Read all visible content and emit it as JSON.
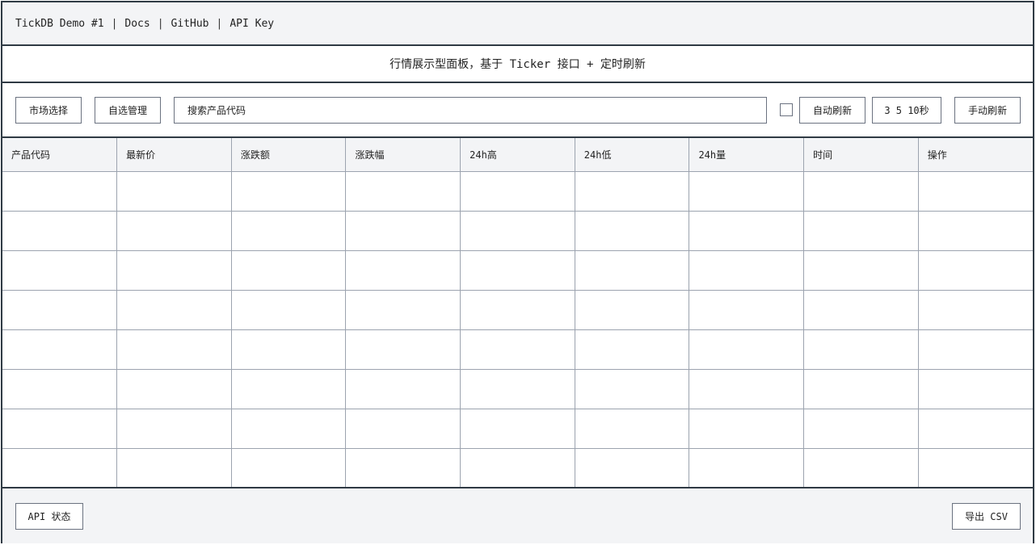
{
  "topbar": {
    "title": "TickDB Demo #1",
    "links": [
      "Docs",
      "GitHub",
      "API Key"
    ],
    "separator": "|"
  },
  "subtitle": "行情展示型面板，基于 Ticker 接口 + 定时刷新",
  "toolbar": {
    "market_label": "市场选择",
    "watchlist_label": "自选管理",
    "search_placeholder": "搜索产品代码",
    "auto_refresh_label": "自动刷新",
    "auto_refresh_checked": false,
    "interval_label": "3 5 10秒",
    "manual_refresh_label": "手动刷新"
  },
  "table": {
    "columns": [
      "产品代码",
      "最新价",
      "涨跌额",
      "涨跌幅",
      "24h高",
      "24h低",
      "24h量",
      "时间",
      "操作"
    ],
    "rows": [
      [
        "",
        "",
        "",
        "",
        "",
        "",
        "",
        "",
        ""
      ],
      [
        "",
        "",
        "",
        "",
        "",
        "",
        "",
        "",
        ""
      ],
      [
        "",
        "",
        "",
        "",
        "",
        "",
        "",
        "",
        ""
      ],
      [
        "",
        "",
        "",
        "",
        "",
        "",
        "",
        "",
        ""
      ],
      [
        "",
        "",
        "",
        "",
        "",
        "",
        "",
        "",
        ""
      ],
      [
        "",
        "",
        "",
        "",
        "",
        "",
        "",
        "",
        ""
      ],
      [
        "",
        "",
        "",
        "",
        "",
        "",
        "",
        "",
        ""
      ],
      [
        "",
        "",
        "",
        "",
        "",
        "",
        "",
        "",
        ""
      ]
    ]
  },
  "footer": {
    "api_status_label": "API 状态",
    "export_label": "导出 CSV"
  }
}
